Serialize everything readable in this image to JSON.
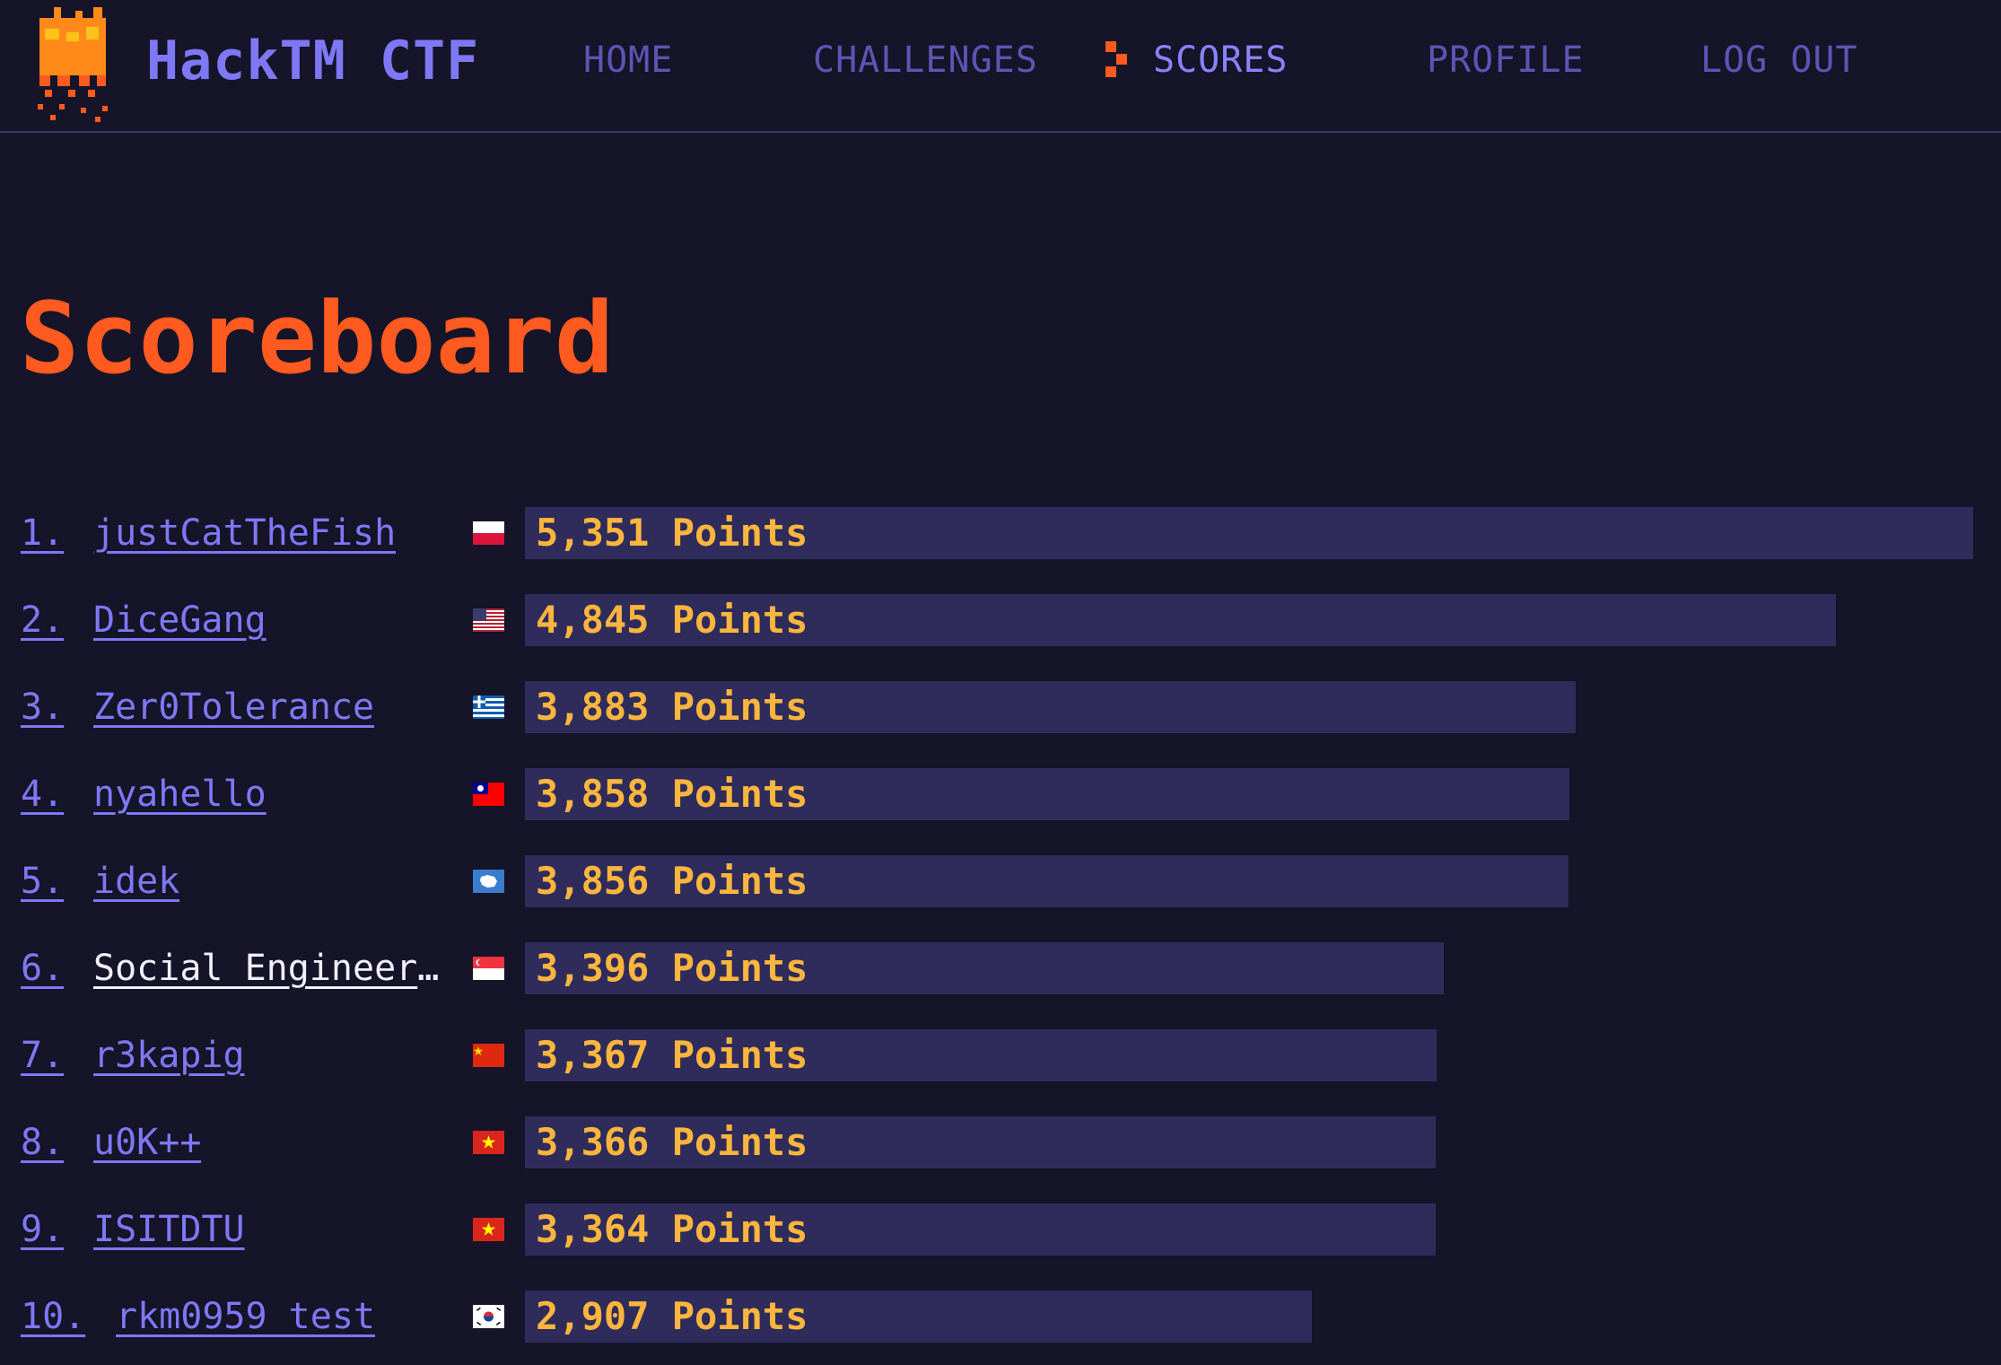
{
  "header": {
    "brand": "HackTM CTF",
    "nav": [
      {
        "label": "HOME",
        "active": false
      },
      {
        "label": "CHALLENGES",
        "active": false
      },
      {
        "label": "SCORES",
        "active": true
      },
      {
        "label": "PROFILE",
        "active": false
      },
      {
        "label": "LOG OUT",
        "active": false
      }
    ]
  },
  "page": {
    "title": "Scoreboard"
  },
  "scoreboard": {
    "max_score": 5351,
    "rows": [
      {
        "rank": "1.",
        "team": "justCatTheFish",
        "flag": "poland-flag-icon",
        "score": 5351,
        "points_label": "5,351 Points",
        "highlight": false
      },
      {
        "rank": "2.",
        "team": "DiceGang",
        "flag": "usa-flag-icon",
        "score": 4845,
        "points_label": "4,845 Points",
        "highlight": false
      },
      {
        "rank": "3.",
        "team": "Zer0Tolerance",
        "flag": "greece-flag-icon",
        "score": 3883,
        "points_label": "3,883 Points",
        "highlight": false
      },
      {
        "rank": "4.",
        "team": "nyahello",
        "flag": "taiwan-flag-icon",
        "score": 3858,
        "points_label": "3,858 Points",
        "highlight": false
      },
      {
        "rank": "5.",
        "team": "idek",
        "flag": "antarctica-flag-icon",
        "score": 3856,
        "points_label": "3,856 Points",
        "highlight": false
      },
      {
        "rank": "6.",
        "team": "Social_Engineering_Experts",
        "flag": "singapore-flag-icon",
        "score": 3396,
        "points_label": "3,396 Points",
        "highlight": true
      },
      {
        "rank": "7.",
        "team": "r3kapig",
        "flag": "china-flag-icon",
        "score": 3367,
        "points_label": "3,367 Points",
        "highlight": false
      },
      {
        "rank": "8.",
        "team": "u0K++",
        "flag": "vietnam-flag-icon",
        "score": 3366,
        "points_label": "3,366 Points",
        "highlight": false
      },
      {
        "rank": "9.",
        "team": "ISITDTU",
        "flag": "vietnam-flag-icon",
        "score": 3364,
        "points_label": "3,364 Points",
        "highlight": false
      },
      {
        "rank": "10.",
        "team": "rkm0959_test",
        "flag": "south-korea-flag-icon",
        "score": 2907,
        "points_label": "2,907 Points",
        "highlight": false
      }
    ]
  },
  "colors": {
    "background": "#151428",
    "accent_orange": "#ff5a1f",
    "link_purple": "#7f78f5",
    "bar": "#2f2c5c",
    "points_yellow": "#fcb63d"
  }
}
